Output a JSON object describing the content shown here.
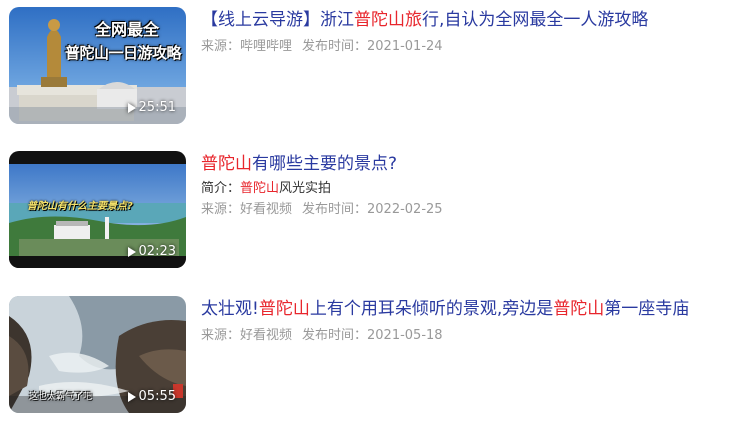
{
  "results": [
    {
      "title_parts": [
        "【线上云导游】浙江",
        "普陀山",
        "旅",
        "行,自认为全网最全一人游攻略"
      ],
      "thumbnail_text": [
        "全网最全",
        "普陀山一日游攻略"
      ],
      "duration": "25:51",
      "source_label": "来源：哔哩哔哩",
      "date_label": "发布时间：2021-01-24"
    },
    {
      "title_parts": [
        "普陀山",
        "有哪些主要的景点?"
      ],
      "thumbnail_text": [
        "普陀山有什么主要景点?"
      ],
      "duration": "02:23",
      "intro_parts": [
        "简介：",
        "普陀山",
        "风光实拍"
      ],
      "source_label": "来源：好看视频",
      "date_label": "发布时间：2022-02-25"
    },
    {
      "title_parts": [
        "太壮观!",
        "普陀山",
        "上有个用耳朵倾听的景观,旁边是",
        "普陀山",
        "第一座寺庙"
      ],
      "thumbnail_text": [
        "这也太霸气了吧"
      ],
      "duration": "05:55",
      "source_label": "来源：好看视频",
      "date_label": "发布时间：2021-05-18"
    }
  ],
  "colors": {
    "title": "#2a3aa0",
    "highlight": "#e8262d",
    "meta": "#999999"
  },
  "icons": [
    "play-icon"
  ]
}
